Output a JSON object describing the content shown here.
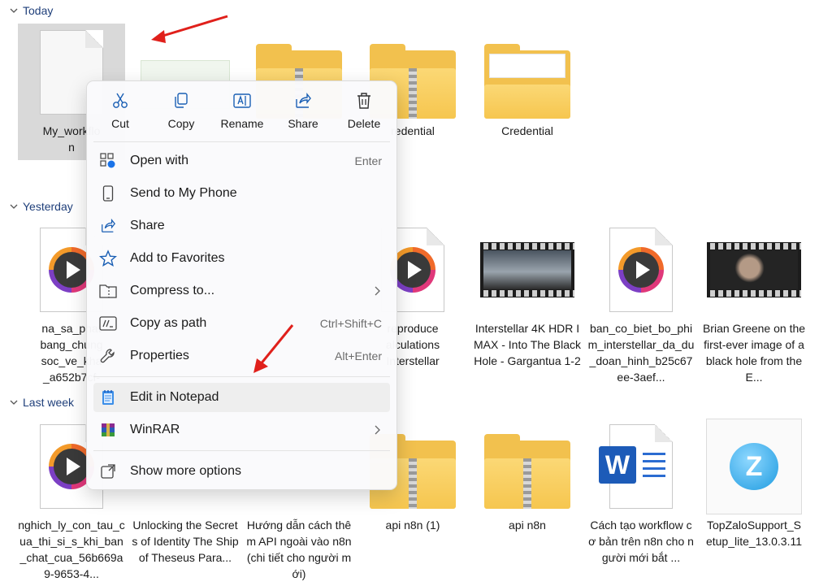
{
  "groups": {
    "today": "Today",
    "yesterday": "Yesterday",
    "last_week": "Last week"
  },
  "today_files": [
    {
      "caption": "My_workflo\nn",
      "kind": "blank"
    },
    {
      "caption": "",
      "kind": "image"
    },
    {
      "caption": "",
      "kind": "zip-folder"
    },
    {
      "caption": "redential",
      "kind": "zip-folder"
    },
    {
      "caption": "Credential",
      "kind": "folder-preview"
    }
  ],
  "yesterday_files": [
    {
      "caption": "na_sa_phat\nbang_chung\nsoc_ve_kha\n_a652b7cf-",
      "kind": "media"
    },
    {
      "caption": "reproduce\nalculations\nInterstellar",
      "kind": "media"
    },
    {
      "caption": "Interstellar 4K HDR IMAX - Into The Black Hole - Gargantua 1-2",
      "kind": "film-horizon"
    },
    {
      "caption": "ban_co_biet_bo_phim_interstellar_da_du_doan_hinh_b25c67ee-3aef...",
      "kind": "media"
    },
    {
      "caption": "Brian Greene on the first-ever image of a black hole from the E...",
      "kind": "film-person"
    }
  ],
  "lastweek_files": [
    {
      "caption": "nghich_ly_con_tau_cua_thi_si_s_khi_ban_chat_cua_56b669a9-9653-4...",
      "kind": "media"
    },
    {
      "caption": "Unlocking the Secrets of Identity The Ship of Theseus Para...",
      "kind": "film"
    },
    {
      "caption": "Hướng dẫn cách thêm API ngoài vào n8n (chi tiết cho người mới)",
      "kind": "doc"
    },
    {
      "caption": "api n8n (1)",
      "kind": "zip-folder"
    },
    {
      "caption": "api n8n",
      "kind": "zip-folder"
    },
    {
      "caption": "Cách tạo workflow cơ bản trên n8n cho người mới bắt ...",
      "kind": "word"
    },
    {
      "caption": "TopZaloSupport_Setup_lite_13.0.3.11",
      "kind": "zalo"
    }
  ],
  "context_menu": {
    "quick_actions": [
      {
        "label": "Cut",
        "icon": "scissors-icon"
      },
      {
        "label": "Copy",
        "icon": "copy-icon"
      },
      {
        "label": "Rename",
        "icon": "rename-icon"
      },
      {
        "label": "Share",
        "icon": "share-icon"
      },
      {
        "label": "Delete",
        "icon": "trash-icon"
      }
    ],
    "items": [
      {
        "label": "Open with",
        "shortcut": "Enter",
        "icon": "open-with-icon"
      },
      {
        "label": "Send to My Phone",
        "shortcut": "",
        "icon": "phone-icon"
      },
      {
        "label": "Share",
        "shortcut": "",
        "icon": "share-icon"
      },
      {
        "label": "Add to Favorites",
        "shortcut": "",
        "icon": "star-icon"
      },
      {
        "label": "Compress to...",
        "shortcut": "",
        "icon": "compress-icon"
      },
      {
        "label": "Copy as path",
        "shortcut": "Ctrl+Shift+C",
        "icon": "copy-path-icon"
      },
      {
        "label": "Properties",
        "shortcut": "Alt+Enter",
        "icon": "wrench-icon"
      },
      {
        "label": "Edit in Notepad",
        "shortcut": "",
        "icon": "notepad-icon"
      },
      {
        "label": "WinRAR",
        "shortcut": "",
        "icon": "winrar-icon"
      },
      {
        "label": "Show more options",
        "shortcut": "",
        "icon": "more-options-icon"
      }
    ]
  },
  "colors": {
    "accent_arrow": "#e0201b",
    "group_header": "#1f3f7a",
    "selection": "#d9d9d9"
  }
}
